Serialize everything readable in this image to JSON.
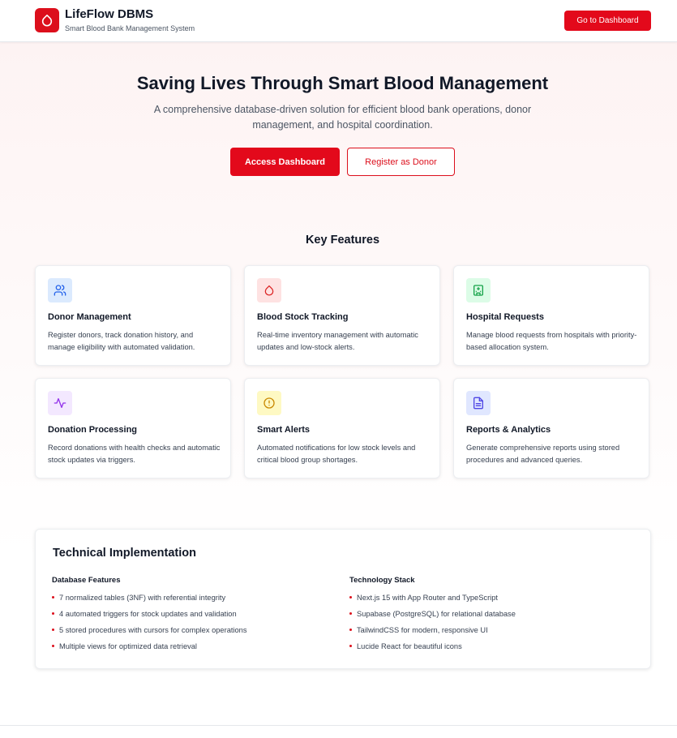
{
  "header": {
    "title": "LifeFlow DBMS",
    "subtitle": "Smart Blood Bank Management System",
    "cta": "Go to Dashboard"
  },
  "hero": {
    "title": "Saving Lives Through Smart Blood Management",
    "subtitle": "A comprehensive database-driven solution for efficient blood bank operations, donor management, and hospital coordination.",
    "primary_button": "Access Dashboard",
    "secondary_button": "Register as Donor"
  },
  "features": {
    "title": "Key Features",
    "items": [
      {
        "title": "Donor Management",
        "description": "Register donors, track donation history, and manage eligibility with automated validation.",
        "icon": "users-icon",
        "color": "#2563eb",
        "bg": "#dbeafe"
      },
      {
        "title": "Blood Stock Tracking",
        "description": "Real-time inventory management with automatic updates and low-stock alerts.",
        "icon": "droplet-icon",
        "color": "#dc2626",
        "bg": "#fee2e2"
      },
      {
        "title": "Hospital Requests",
        "description": "Manage blood requests from hospitals with priority-based allocation system.",
        "icon": "hospital-icon",
        "color": "#16a34a",
        "bg": "#dcfce7"
      },
      {
        "title": "Donation Processing",
        "description": "Record donations with health checks and automatic stock updates via triggers.",
        "icon": "activity-icon",
        "color": "#9333ea",
        "bg": "#f3e8ff"
      },
      {
        "title": "Smart Alerts",
        "description": "Automated notifications for low stock levels and critical blood group shortages.",
        "icon": "alert-circle-icon",
        "color": "#ca8a04",
        "bg": "#fef9c3"
      },
      {
        "title": "Reports & Analytics",
        "description": "Generate comprehensive reports using stored procedures and advanced queries.",
        "icon": "file-text-icon",
        "color": "#4f46e5",
        "bg": "#e0e7ff"
      }
    ]
  },
  "technical": {
    "title": "Technical Implementation",
    "database": {
      "heading": "Database Features",
      "items": [
        "7 normalized tables (3NF) with referential integrity",
        "4 automated triggers for stock updates and validation",
        "5 stored procedures with cursors for complex operations",
        "Multiple views for optimized data retrieval"
      ]
    },
    "stack": {
      "heading": "Technology Stack",
      "items": [
        "Next.js 15 with App Router and TypeScript",
        "Supabase (PostgreSQL) for relational database",
        "TailwindCSS for modern, responsive UI",
        "Lucide React for beautiful icons"
      ]
    }
  },
  "colors": {
    "accent": "#e3091b"
  }
}
